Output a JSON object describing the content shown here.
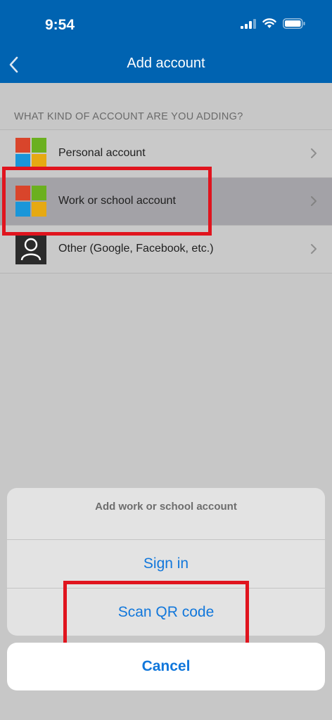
{
  "status_bar": {
    "time": "9:54"
  },
  "nav": {
    "title": "Add account"
  },
  "section": {
    "label": "WHAT KIND OF ACCOUNT ARE YOU ADDING?"
  },
  "accounts": [
    {
      "label": "Personal account",
      "icon": "microsoft-logo-icon"
    },
    {
      "label": "Work or school account",
      "icon": "microsoft-logo-icon",
      "selected": true
    },
    {
      "label": "Other (Google, Facebook, etc.)",
      "icon": "person-icon"
    }
  ],
  "action_sheet": {
    "title": "Add work or school account",
    "sign_in": "Sign in",
    "scan_qr": "Scan QR code",
    "cancel": "Cancel"
  },
  "colors": {
    "header": "#0063b1",
    "accent": "#1177db",
    "highlight": "#e0141e",
    "ms_red": "#d9452b",
    "ms_green": "#6bb01f",
    "ms_blue": "#1a96d9",
    "ms_yellow": "#e6a912"
  }
}
